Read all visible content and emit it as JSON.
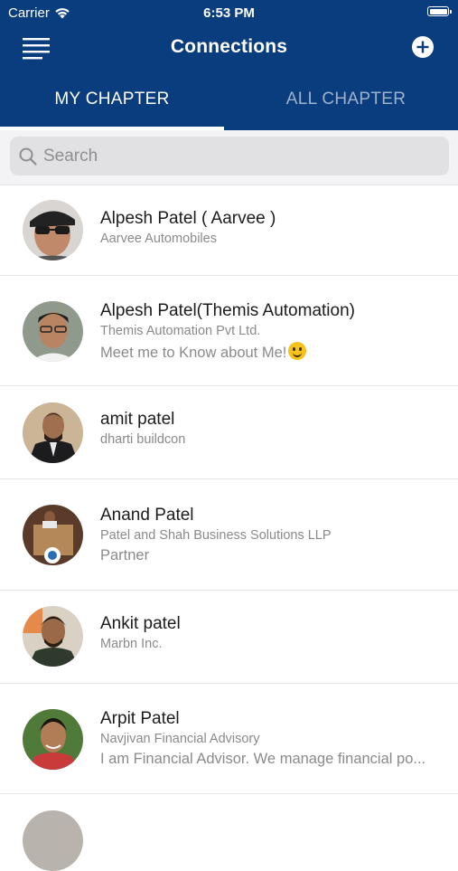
{
  "status_bar": {
    "carrier": "Carrier",
    "time": "6:53 PM"
  },
  "header": {
    "title": "Connections",
    "menu_icon": "hamburger-menu-icon",
    "add_icon": "plus-circle-icon"
  },
  "tabs": [
    {
      "label": "MY CHAPTER",
      "active": true
    },
    {
      "label": "ALL CHAPTER",
      "active": false
    }
  ],
  "search": {
    "placeholder": "Search",
    "value": ""
  },
  "contacts": [
    {
      "name": "Alpesh Patel  ( Aarvee )",
      "company": "Aarvee Automobiles",
      "about": ""
    },
    {
      "name": "Alpesh Patel(Themis Automation)",
      "company": "Themis Automation Pvt Ltd.",
      "about": "Meet me to Know about Me!"
    },
    {
      "name": "amit patel",
      "company": "dharti buildcon",
      "about": ""
    },
    {
      "name": "Anand Patel",
      "company": "Patel and Shah Business Solutions LLP",
      "about": "Partner"
    },
    {
      "name": "Ankit patel",
      "company": "Marbn Inc.",
      "about": ""
    },
    {
      "name": "Arpit Patel",
      "company": "Navjivan Financial Advisory",
      "about": "I am Financial Advisor. We manage financial po..."
    }
  ],
  "colors": {
    "header": "#0a3d7e",
    "tab_inactive": "#9fb1cb",
    "search_bg": "#e1e1e4"
  }
}
